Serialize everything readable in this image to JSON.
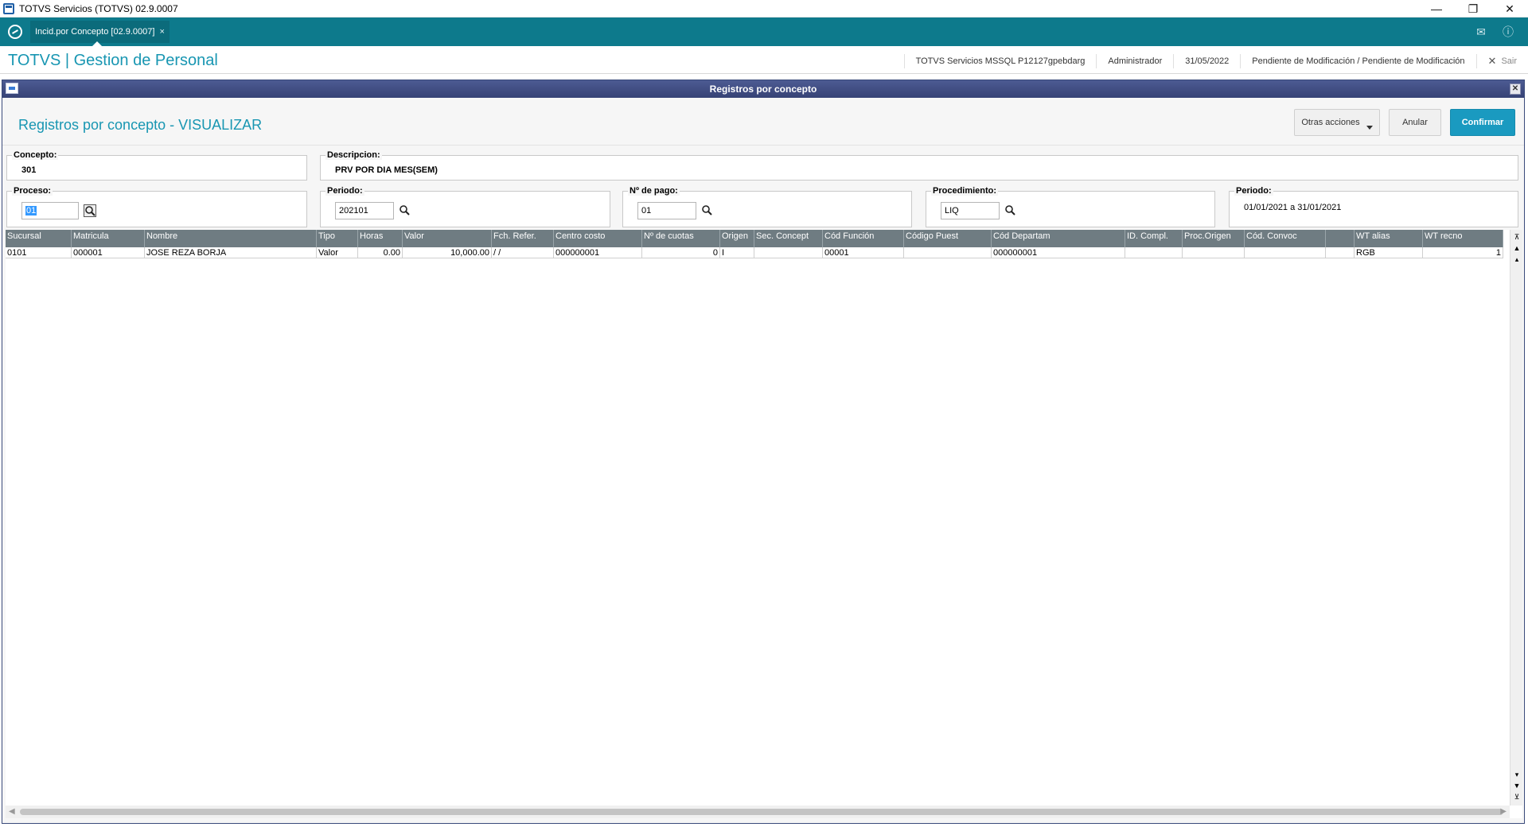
{
  "window": {
    "title": "TOTVS Servicios (TOTVS) 02.9.0007"
  },
  "tab": {
    "label": "Incid.por Concepto [02.9.0007]",
    "close": "×"
  },
  "header": {
    "brand": "TOTVS | Gestion de Personal",
    "server": "TOTVS Servicios MSSQL P12127gpebdarg",
    "user": "Administrador",
    "date": "31/05/2022",
    "status": "Pendiente de Modificación / Pendiente de Modificación",
    "exit": "Sair"
  },
  "dialog": {
    "title": "Registros por concepto",
    "view_title": "Registros por concepto - VISUALIZAR",
    "buttons": {
      "otras": "Otras acciones",
      "anular": "Anular",
      "confirmar": "Confirmar"
    }
  },
  "fields": {
    "concepto": {
      "label": "Concepto:",
      "value": "301"
    },
    "descripcion": {
      "label": "Descripcion:",
      "value": "PRV POR DIA MES(SEM)"
    },
    "proceso": {
      "label": "Proceso:",
      "value": "01"
    },
    "periodo": {
      "label": "Periodo:",
      "value": "202101"
    },
    "nro_pago": {
      "label": "Nº de pago:",
      "value": "01"
    },
    "procedimiento": {
      "label": "Procedimiento:",
      "value": "LIQ"
    },
    "periodo_rango": {
      "label": "Periodo:",
      "value": "01/01/2021 a 31/01/2021"
    }
  },
  "grid": {
    "columns": [
      "Sucursal",
      "Matricula",
      "Nombre",
      "Tipo",
      "Horas",
      "Valor",
      "Fch. Refer.",
      "Centro costo",
      "Nº de cuotas",
      "Origen",
      "Sec. Concept",
      "Cód Función",
      "Código Puest",
      "Cód Departam",
      "ID. Compl.",
      "Proc.Origen",
      "Cód. Convoc",
      "",
      "WT alias",
      "WT recno"
    ],
    "rows": [
      [
        "0101",
        "000001",
        "JOSE  REZA BORJA",
        "Valor",
        "0.00",
        "10,000.00",
        " /  /",
        "000000001",
        "0",
        "I",
        "",
        "00001",
        "",
        "000000001",
        "",
        "",
        "",
        "",
        "RGB",
        "1"
      ]
    ]
  }
}
